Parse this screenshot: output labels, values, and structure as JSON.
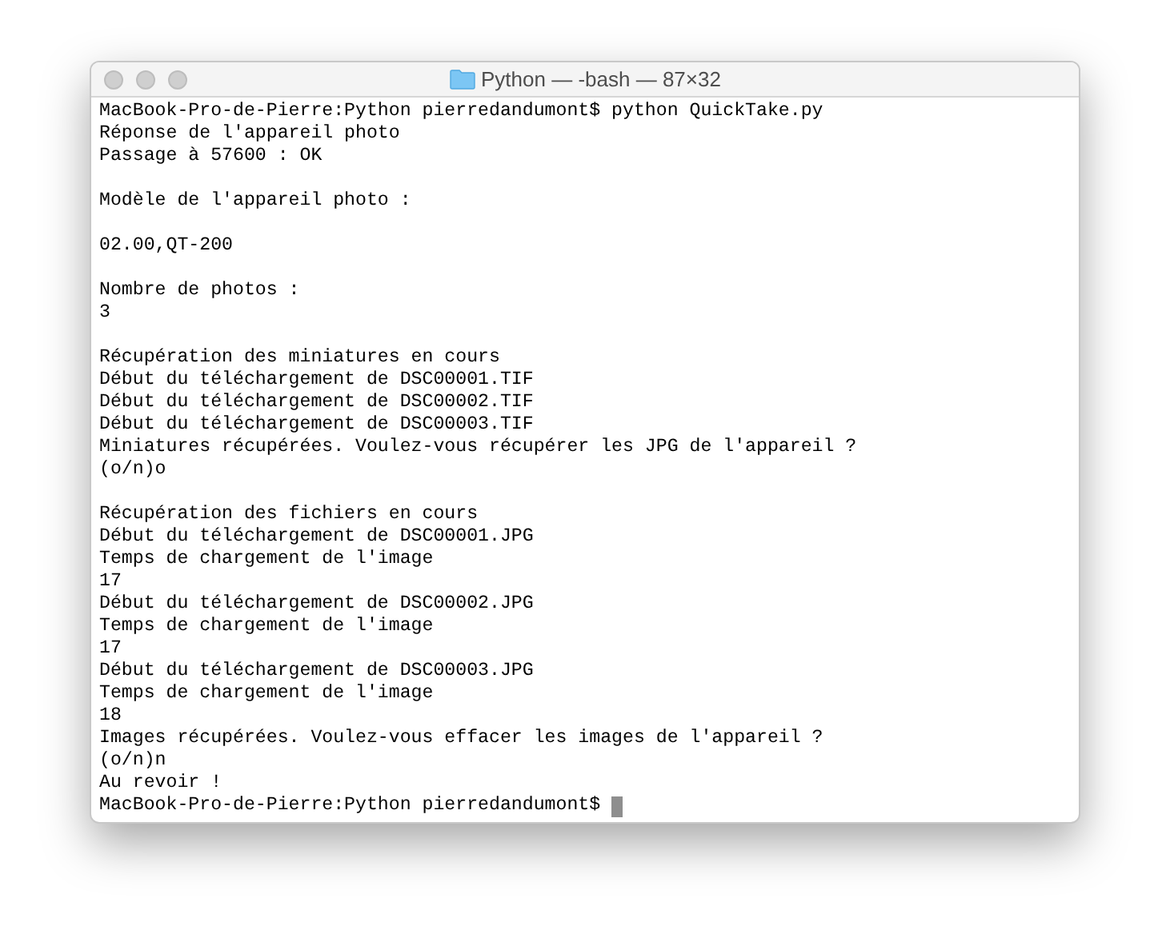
{
  "window": {
    "title": "Python — -bash — 87×32"
  },
  "terminal": {
    "cursor_visible": true,
    "blocks": [
      [
        "MacBook-Pro-de-Pierre:Python pierredandumont$ python QuickTake.py",
        "Réponse de l'appareil photo",
        "Passage à 57600 : OK"
      ],
      [
        "Modèle de l'appareil photo :"
      ],
      [
        "02.00,QT-200"
      ],
      [
        "Nombre de photos :",
        "3"
      ],
      [
        "Récupération des miniatures en cours",
        "Début du téléchargement de DSC00001.TIF",
        "Début du téléchargement de DSC00002.TIF",
        "Début du téléchargement de DSC00003.TIF",
        "Miniatures récupérées. Voulez-vous récupérer les JPG de l'appareil ?",
        "(o/n)o"
      ],
      [
        "Récupération des fichiers en cours",
        "Début du téléchargement de DSC00001.JPG",
        "Temps de chargement de l'image",
        "17",
        "Début du téléchargement de DSC00002.JPG",
        "Temps de chargement de l'image",
        "17",
        "Début du téléchargement de DSC00003.JPG",
        "Temps de chargement de l'image",
        "18",
        "Images récupérées. Voulez-vous effacer les images de l'appareil ?",
        "(o/n)n",
        "Au revoir !",
        "MacBook-Pro-de-Pierre:Python pierredandumont$"
      ]
    ]
  }
}
